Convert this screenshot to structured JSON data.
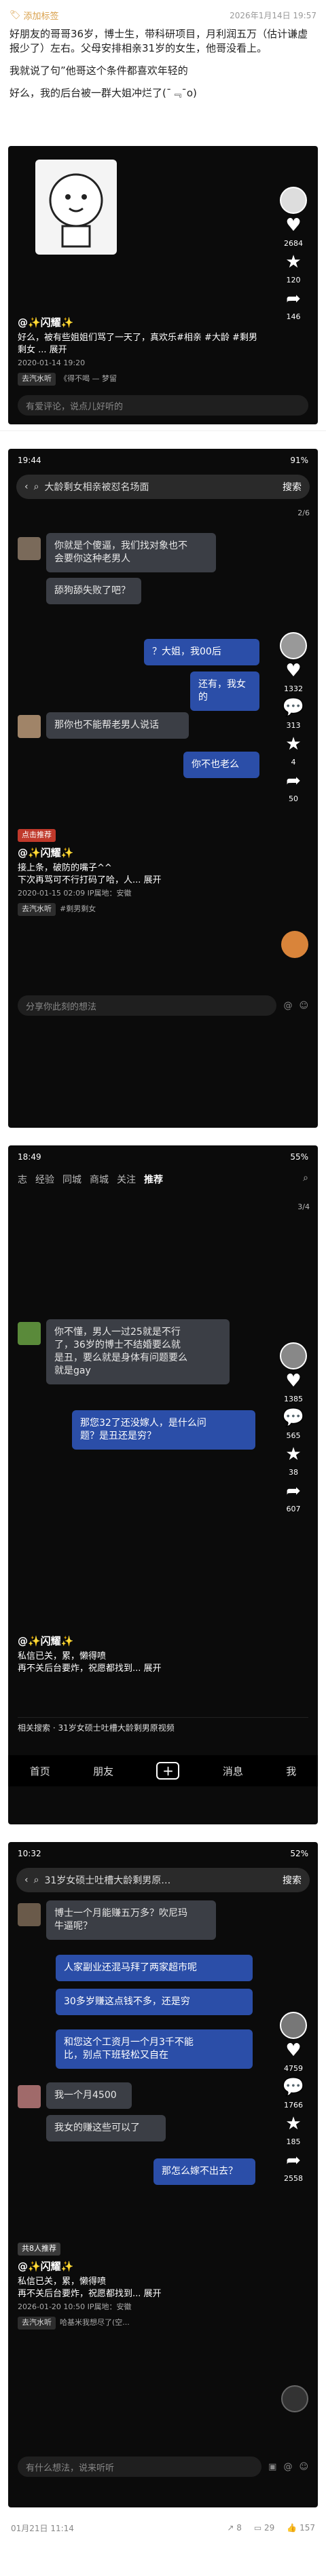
{
  "note": {
    "tag": "添加标签",
    "timestamp": "2026年1月14日 19:57",
    "paragraphs": [
      "好朋友的哥哥36岁，博士生，带科研项目，月利润五万（估计谦虚报少了）左右。父母安排相亲31岁的女生，他哥没看上。",
      "我就说了句”他哥这个条件都喜欢年轻的",
      "好么，我的后台被一群大姐冲烂了(¯﹃¯o)"
    ]
  },
  "card1": {
    "like_count": "2684",
    "fav_count": "120",
    "star_count": "146",
    "share_label": "分享",
    "author": "@✨闪耀✨",
    "desc": "好么，被有些姐姐们骂了一天了，真欢乐#相亲 #大龄 #剩男剩女 ... 展开",
    "date": "2020-01-14 19:20",
    "chip": "去汽水听",
    "music": "《得不喝 — 梦留",
    "comment_placeholder": "有爱评论，说点儿好听的"
  },
  "card2": {
    "status_time": "19:44",
    "status_battery": "91%",
    "search_text": "大龄剩女相亲被怼名场面",
    "search_btn": "搜索",
    "pager": "2/6",
    "msg1": "你就是个傻逼，我们找对象也不\n会要你这种老男人",
    "msg2": "舔狗舔失败了吧？",
    "msg3": "？大姐，我00后",
    "msg4": "还有，我女的",
    "msg5": "那你也不能帮老男人说话",
    "msg6": "你不也老么",
    "c_like": "1332",
    "c_comment": "313",
    "c_fav": "4",
    "c_share": "50",
    "hot_tag": "点击推荐",
    "author": "@✨闪耀✨",
    "desc1": "接上条，破防的嘴子^^",
    "desc2": "下次再骂可不行打码了哈，人... 展开",
    "date": "2020-01-15 02:09",
    "location": "IP属地：安徽",
    "chip": "去汽水听",
    "music": "#剩男剩女",
    "comment_placeholder": "分享你此刻的想法"
  },
  "card3": {
    "status_time": "18:49",
    "status_battery": "55%",
    "tabs": [
      "志",
      "经验",
      "同城",
      "商城",
      "关注",
      "推荐"
    ],
    "pager": "3/4",
    "msg1": "你不懂，男人一过25就是不行\n了，36岁的博士不结婚要么就\n是丑，要么就是身体有问题要么\n就是gay",
    "msg2": "那您32了还没嫁人，是什么问\n题？是丑还是穷？",
    "c_like": "1385",
    "c_comment": "565",
    "c_fav": "38",
    "c_share": "607",
    "author": "@✨闪耀✨",
    "desc1": "私信已关，累，懒得喷",
    "desc2": "再不关后台要炸，祝愿都找到... 展开",
    "related": "相关搜索 · 31岁女硕士吐槽大龄剩男原视频",
    "nav": [
      "首页",
      "朋友",
      "消息",
      "我"
    ]
  },
  "card4": {
    "status_time": "10:32",
    "status_battery": "52%",
    "search_text": "31岁女硕士吐槽大龄剩男原…",
    "search_btn": "搜索",
    "msg1": "博士一个月能赚五万多？吹尼玛\n牛逼呢？",
    "msg2": "人家副业还混马拜了两家超市呢",
    "msg3": "30多岁赚这点钱不多，还是穷",
    "msg4": "和您这个工资月一个月3千不能\n比，别点下班轻松又自在",
    "msg5": "我一个月4500",
    "msg6": "我女的赚这些可以了",
    "msg7": "那怎么嫁不出去？",
    "c_like": "4759",
    "c_comment": "1766",
    "c_fav": "185",
    "c_share": "2558",
    "hot_tag": "共8人推荐",
    "author": "@✨闪耀✨",
    "desc1": "私信已关，累，懒得喷",
    "desc2": "再不关后台要炸，祝愿都找到... 展开",
    "date": "2026-01-20 10:50",
    "location": "IP属地：安徽",
    "chip": "去汽水听",
    "music": "哈基米我想尽了(空...",
    "comment_placeholder": "有什么想法，说来听听"
  },
  "footer": {
    "date": "01月21日 11:14",
    "share_count": "8",
    "comment_count": "29",
    "like_count": "157"
  }
}
